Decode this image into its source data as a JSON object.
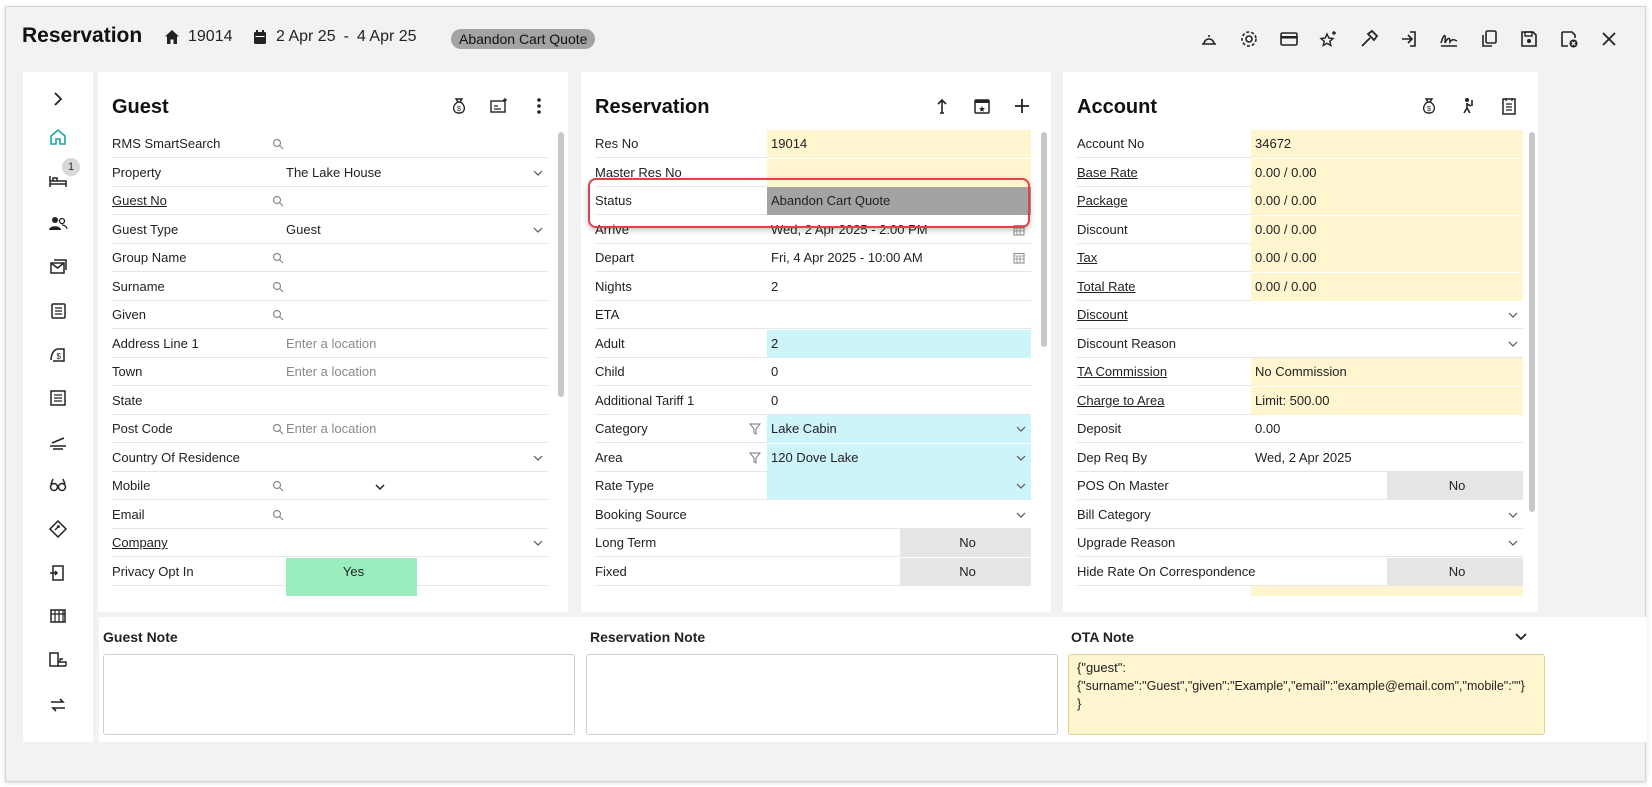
{
  "header": {
    "title": "Reservation",
    "res_no": "19014",
    "dates_from": "2 Apr 25",
    "dates_sep": "-",
    "dates_to": "4 Apr 25",
    "status_tag": "Abandon Cart Quote"
  },
  "sidebar": {
    "badge": "1"
  },
  "guest": {
    "title": "Guest",
    "rows": {
      "smartsearch": "RMS SmartSearch",
      "property": "Property",
      "property_val": "The Lake House",
      "guest_no": "Guest No",
      "guest_type": "Guest Type",
      "guest_type_val": "Guest",
      "group_name": "Group Name",
      "surname": "Surname",
      "given": "Given",
      "address1": "Address Line 1",
      "address1_ph": "Enter a location",
      "town": "Town",
      "town_ph": "Enter a location",
      "state": "State",
      "postcode": "Post Code",
      "postcode_ph": "Enter a location",
      "country": "Country Of Residence",
      "mobile": "Mobile",
      "email": "Email",
      "company": "Company",
      "privacy": "Privacy Opt In",
      "privacy_val": "Yes"
    }
  },
  "reservation": {
    "title": "Reservation",
    "rows": {
      "res_no": "Res No",
      "res_no_val": "19014",
      "master_res_no": "Master Res No",
      "status": "Status",
      "status_val": "Abandon Cart Quote",
      "arrive": "Arrive",
      "arrive_val": "Wed, 2 Apr 2025 - 2:00 PM",
      "depart": "Depart",
      "depart_val": "Fri, 4 Apr 2025 - 10:00 AM",
      "nights": "Nights",
      "nights_val": "2",
      "eta": "ETA",
      "adult": "Adult",
      "adult_val": "2",
      "child": "Child",
      "child_val": "0",
      "tariff": "Additional Tariff 1",
      "tariff_val": "0",
      "category": "Category",
      "category_val": "Lake Cabin",
      "area": "Area",
      "area_val": "120 Dove Lake",
      "rate_type": "Rate Type",
      "booking_source": "Booking Source",
      "long_term": "Long Term",
      "long_term_val": "No",
      "fixed": "Fixed",
      "fixed_val": "No"
    }
  },
  "account": {
    "title": "Account",
    "rows": {
      "account_no": "Account No",
      "account_no_val": "34672",
      "base_rate": "Base Rate",
      "base_rate_val": "0.00 / 0.00",
      "package": "Package",
      "package_val": "0.00 / 0.00",
      "discount": "Discount",
      "discount_val": "0.00 / 0.00",
      "tax": "Tax",
      "tax_val": "0.00 / 0.00",
      "total_rate": "Total Rate",
      "total_rate_val": "0.00 / 0.00",
      "discount2": "Discount",
      "discount_reason": "Discount Reason",
      "ta_commission": "TA Commission",
      "ta_commission_val": "No Commission",
      "charge_to_area": "Charge to Area",
      "charge_to_area_val": "Limit: 500.00",
      "deposit": "Deposit",
      "deposit_val": "0.00",
      "dep_req_by": "Dep Req By",
      "dep_req_by_val": "Wed, 2 Apr 2025",
      "pos_on_master": "POS On Master",
      "pos_on_master_val": "No",
      "bill_category": "Bill Category",
      "upgrade_reason": "Upgrade Reason",
      "hide_rate": "Hide Rate On Correspondence",
      "hide_rate_val": "No"
    }
  },
  "notes": {
    "guest_note": "Guest Note",
    "reservation_note": "Reservation Note",
    "ota_note": "OTA Note",
    "ota_note_line1": "{\"guest\":",
    "ota_note_line2": "{\"surname\":\"Guest\",\"given\":\"Example\",\"email\":\"example@email.com\",\"mobile\":\"\"}",
    "ota_note_line3": "}"
  }
}
